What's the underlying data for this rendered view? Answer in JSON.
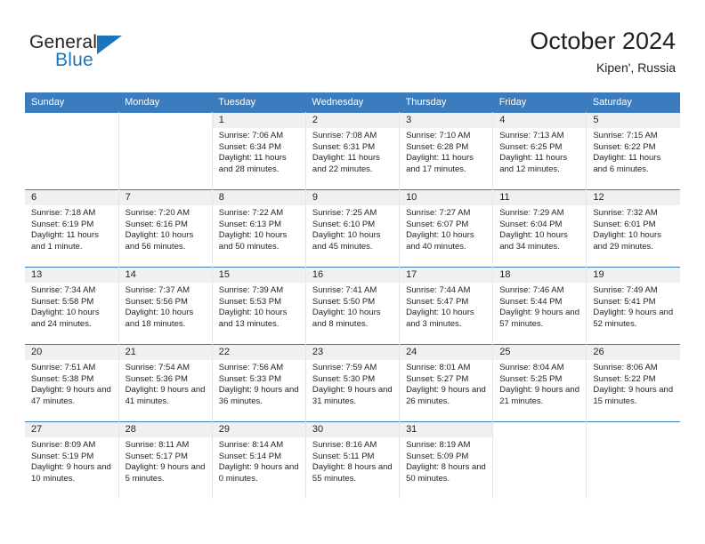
{
  "brand": {
    "name_part1": "General",
    "name_part2": "Blue",
    "triangle_icon": "triangle-icon",
    "accent_color": "#1b75bb"
  },
  "header": {
    "title": "October 2024",
    "location": "Kipen', Russia"
  },
  "colors": {
    "header_row_bg": "#3a7cbe",
    "daynum_band_bg": "#f0f0f0",
    "row_divider": "#3a7cbe",
    "cell_divider": "#e6e6e6",
    "text": "#231f20"
  },
  "weekday_headers": [
    "Sunday",
    "Monday",
    "Tuesday",
    "Wednesday",
    "Thursday",
    "Friday",
    "Saturday"
  ],
  "weeks": [
    [
      {
        "day": "",
        "blank": true
      },
      {
        "day": "",
        "blank": true
      },
      {
        "day": "1",
        "sunrise": "Sunrise: 7:06 AM",
        "sunset": "Sunset: 6:34 PM",
        "daylight": "Daylight: 11 hours and 28 minutes."
      },
      {
        "day": "2",
        "sunrise": "Sunrise: 7:08 AM",
        "sunset": "Sunset: 6:31 PM",
        "daylight": "Daylight: 11 hours and 22 minutes."
      },
      {
        "day": "3",
        "sunrise": "Sunrise: 7:10 AM",
        "sunset": "Sunset: 6:28 PM",
        "daylight": "Daylight: 11 hours and 17 minutes."
      },
      {
        "day": "4",
        "sunrise": "Sunrise: 7:13 AM",
        "sunset": "Sunset: 6:25 PM",
        "daylight": "Daylight: 11 hours and 12 minutes."
      },
      {
        "day": "5",
        "sunrise": "Sunrise: 7:15 AM",
        "sunset": "Sunset: 6:22 PM",
        "daylight": "Daylight: 11 hours and 6 minutes."
      }
    ],
    [
      {
        "day": "6",
        "sunrise": "Sunrise: 7:18 AM",
        "sunset": "Sunset: 6:19 PM",
        "daylight": "Daylight: 11 hours and 1 minute."
      },
      {
        "day": "7",
        "sunrise": "Sunrise: 7:20 AM",
        "sunset": "Sunset: 6:16 PM",
        "daylight": "Daylight: 10 hours and 56 minutes."
      },
      {
        "day": "8",
        "sunrise": "Sunrise: 7:22 AM",
        "sunset": "Sunset: 6:13 PM",
        "daylight": "Daylight: 10 hours and 50 minutes."
      },
      {
        "day": "9",
        "sunrise": "Sunrise: 7:25 AM",
        "sunset": "Sunset: 6:10 PM",
        "daylight": "Daylight: 10 hours and 45 minutes."
      },
      {
        "day": "10",
        "sunrise": "Sunrise: 7:27 AM",
        "sunset": "Sunset: 6:07 PM",
        "daylight": "Daylight: 10 hours and 40 minutes."
      },
      {
        "day": "11",
        "sunrise": "Sunrise: 7:29 AM",
        "sunset": "Sunset: 6:04 PM",
        "daylight": "Daylight: 10 hours and 34 minutes."
      },
      {
        "day": "12",
        "sunrise": "Sunrise: 7:32 AM",
        "sunset": "Sunset: 6:01 PM",
        "daylight": "Daylight: 10 hours and 29 minutes."
      }
    ],
    [
      {
        "day": "13",
        "sunrise": "Sunrise: 7:34 AM",
        "sunset": "Sunset: 5:58 PM",
        "daylight": "Daylight: 10 hours and 24 minutes."
      },
      {
        "day": "14",
        "sunrise": "Sunrise: 7:37 AM",
        "sunset": "Sunset: 5:56 PM",
        "daylight": "Daylight: 10 hours and 18 minutes."
      },
      {
        "day": "15",
        "sunrise": "Sunrise: 7:39 AM",
        "sunset": "Sunset: 5:53 PM",
        "daylight": "Daylight: 10 hours and 13 minutes."
      },
      {
        "day": "16",
        "sunrise": "Sunrise: 7:41 AM",
        "sunset": "Sunset: 5:50 PM",
        "daylight": "Daylight: 10 hours and 8 minutes."
      },
      {
        "day": "17",
        "sunrise": "Sunrise: 7:44 AM",
        "sunset": "Sunset: 5:47 PM",
        "daylight": "Daylight: 10 hours and 3 minutes."
      },
      {
        "day": "18",
        "sunrise": "Sunrise: 7:46 AM",
        "sunset": "Sunset: 5:44 PM",
        "daylight": "Daylight: 9 hours and 57 minutes."
      },
      {
        "day": "19",
        "sunrise": "Sunrise: 7:49 AM",
        "sunset": "Sunset: 5:41 PM",
        "daylight": "Daylight: 9 hours and 52 minutes."
      }
    ],
    [
      {
        "day": "20",
        "sunrise": "Sunrise: 7:51 AM",
        "sunset": "Sunset: 5:38 PM",
        "daylight": "Daylight: 9 hours and 47 minutes."
      },
      {
        "day": "21",
        "sunrise": "Sunrise: 7:54 AM",
        "sunset": "Sunset: 5:36 PM",
        "daylight": "Daylight: 9 hours and 41 minutes."
      },
      {
        "day": "22",
        "sunrise": "Sunrise: 7:56 AM",
        "sunset": "Sunset: 5:33 PM",
        "daylight": "Daylight: 9 hours and 36 minutes."
      },
      {
        "day": "23",
        "sunrise": "Sunrise: 7:59 AM",
        "sunset": "Sunset: 5:30 PM",
        "daylight": "Daylight: 9 hours and 31 minutes."
      },
      {
        "day": "24",
        "sunrise": "Sunrise: 8:01 AM",
        "sunset": "Sunset: 5:27 PM",
        "daylight": "Daylight: 9 hours and 26 minutes."
      },
      {
        "day": "25",
        "sunrise": "Sunrise: 8:04 AM",
        "sunset": "Sunset: 5:25 PM",
        "daylight": "Daylight: 9 hours and 21 minutes."
      },
      {
        "day": "26",
        "sunrise": "Sunrise: 8:06 AM",
        "sunset": "Sunset: 5:22 PM",
        "daylight": "Daylight: 9 hours and 15 minutes."
      }
    ],
    [
      {
        "day": "27",
        "sunrise": "Sunrise: 8:09 AM",
        "sunset": "Sunset: 5:19 PM",
        "daylight": "Daylight: 9 hours and 10 minutes."
      },
      {
        "day": "28",
        "sunrise": "Sunrise: 8:11 AM",
        "sunset": "Sunset: 5:17 PM",
        "daylight": "Daylight: 9 hours and 5 minutes."
      },
      {
        "day": "29",
        "sunrise": "Sunrise: 8:14 AM",
        "sunset": "Sunset: 5:14 PM",
        "daylight": "Daylight: 9 hours and 0 minutes."
      },
      {
        "day": "30",
        "sunrise": "Sunrise: 8:16 AM",
        "sunset": "Sunset: 5:11 PM",
        "daylight": "Daylight: 8 hours and 55 minutes."
      },
      {
        "day": "31",
        "sunrise": "Sunrise: 8:19 AM",
        "sunset": "Sunset: 5:09 PM",
        "daylight": "Daylight: 8 hours and 50 minutes."
      },
      {
        "day": "",
        "blank": true
      },
      {
        "day": "",
        "blank": true
      }
    ]
  ]
}
